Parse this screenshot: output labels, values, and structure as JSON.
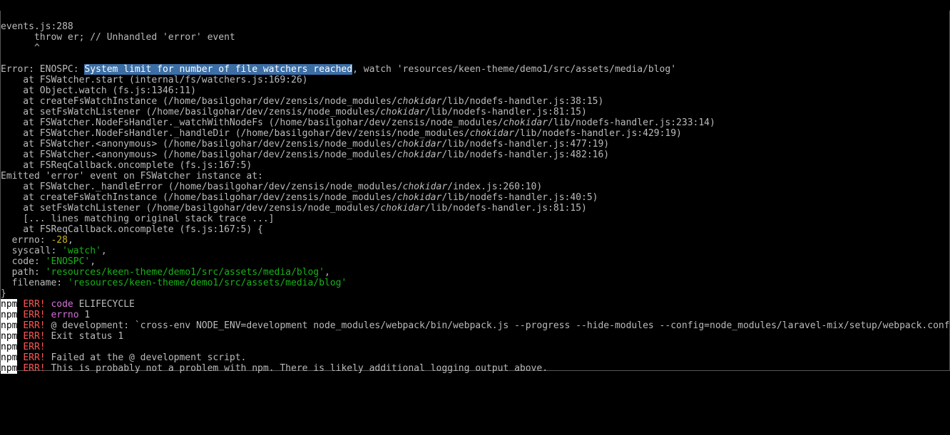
{
  "chokidar": "chokidar",
  "stack": {
    "l0": "events.js:288",
    "l1": "      throw er; // Unhandled 'error' event",
    "l2": "      ^"
  },
  "err": {
    "prefix": "Error: ENOSPC: ",
    "highlighted": "System limit for number of file watchers reached",
    "suffix": ", watch 'resources/keen-theme/demo1/src/assets/media/blog'"
  },
  "trace": {
    "0": "    at FSWatcher.start (internal/fs/watchers.js:169:26)",
    "1": "    at Object.watch (fs.js:1346:11)",
    "2a": "    at createFsWatchInstance (/home/basilgohar/dev/zensis/node_modules/",
    "2b": "/lib/nodefs-handler.js:38:15)",
    "3a": "    at setFsWatchListener (/home/basilgohar/dev/zensis/node_modules/",
    "3b": "/lib/nodefs-handler.js:81:15)",
    "4a": "    at FSWatcher.NodeFsHandler._watchWithNodeFs (/home/basilgohar/dev/zensis/node_modules/",
    "4b": "/lib/nodefs-handler.js:233:14)",
    "5a": "    at FSWatcher.NodeFsHandler._handleDir (/home/basilgohar/dev/zensis/node_modules/",
    "5b": "/lib/nodefs-handler.js:429:19)",
    "6a": "    at FSWatcher.<anonymous> (/home/basilgohar/dev/zensis/node_modules/",
    "6b": "/lib/nodefs-handler.js:477:19)",
    "7a": "    at FSWatcher.<anonymous> (/home/basilgohar/dev/zensis/node_modules/",
    "7b": "/lib/nodefs-handler.js:482:16)",
    "8": "    at FSReqCallback.oncomplete (fs.js:167:5)",
    "9": "Emitted 'error' event on FSWatcher instance at:",
    "10a": "    at FSWatcher._handleError (/home/basilgohar/dev/zensis/node_modules/",
    "10b": "/index.js:260:10)",
    "11a": "    at createFsWatchInstance (/home/basilgohar/dev/zensis/node_modules/",
    "11b": "/lib/nodefs-handler.js:40:5)",
    "12a": "    at setFsWatchListener (/home/basilgohar/dev/zensis/node_modules/",
    "12b": "/lib/nodefs-handler.js:81:15)",
    "13": "    [... lines matching original stack trace ...]",
    "14": "    at FSReqCallback.oncomplete (fs.js:167:5) {"
  },
  "obj": {
    "errno_pre": "  errno: ",
    "errno_val": "-28",
    "syscall_pre": "  syscall: ",
    "syscall_val": "'watch'",
    "code_pre": "  code: ",
    "code_val": "'ENOSPC'",
    "path_pre": "  path: ",
    "path_val": "'resources/keen-theme/demo1/src/assets/media/blog'",
    "filename_pre": "  filename: ",
    "filename_val": "'resources/keen-theme/demo1/src/assets/media/blog'",
    "close": "}"
  },
  "npm": {
    "tag": "npm",
    "err": "ERR!",
    "lines": [
      {
        "k": "code",
        "v": "ELIFECYCLE"
      },
      {
        "k": "errno",
        "v": "1"
      },
      {
        "k": "",
        "v": "@ development: `cross-env NODE_ENV=development node_modules/webpack/bin/webpack.js --progress --hide-modules --config=node_modules/laravel-mix/setup/webpack.config.js \"--watch\"`"
      },
      {
        "k": "",
        "v": "Exit status 1"
      },
      {
        "k": "",
        "v": ""
      },
      {
        "k": "",
        "v": "Failed at the @ development script."
      },
      {
        "k": "",
        "v": "This is probably not a problem with npm. There is likely additional logging output above."
      }
    ]
  }
}
